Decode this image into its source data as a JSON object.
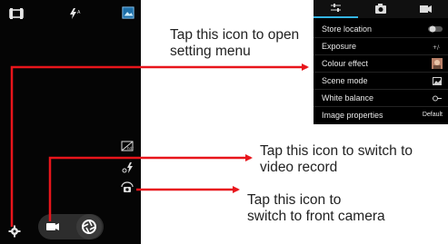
{
  "camera": {
    "top_icons": [
      "panorama-icon",
      "flash-auto-icon",
      "gallery-icon"
    ],
    "side_icons": [
      "hdr-icon",
      "flash-icon",
      "switch-camera-icon"
    ],
    "bottom_left_icon": "settings-gear-icon",
    "capture_buttons": [
      "video-camera-icon",
      "shutter-icon"
    ]
  },
  "settings": {
    "tabs": [
      {
        "icon": "sliders-icon",
        "active": true
      },
      {
        "icon": "camera-icon",
        "active": false
      },
      {
        "icon": "video-icon",
        "active": false
      }
    ],
    "rows": [
      {
        "label": "Store location",
        "value": "",
        "control": "toggle-off"
      },
      {
        "label": "Exposure",
        "value": "",
        "control": "exposure-icon"
      },
      {
        "label": "Colour effect",
        "value": "",
        "control": "effect-thumbnail"
      },
      {
        "label": "Scene mode",
        "value": "",
        "control": "scene-icon"
      },
      {
        "label": "White balance",
        "value": "",
        "control": "wb-icon"
      },
      {
        "label": "Image properties",
        "value": "Default",
        "control": "text"
      }
    ],
    "accent_color": "#33b5e5"
  },
  "annotations": {
    "setting_menu_line1": "Tap this icon to open",
    "setting_menu_line2": "setting menu",
    "video_line1": "Tap this icon to switch to",
    "video_line2": "video record",
    "front_line1": "Tap this icon to",
    "front_line2": "switch to front camera",
    "arrow_color": "#e8151b"
  }
}
